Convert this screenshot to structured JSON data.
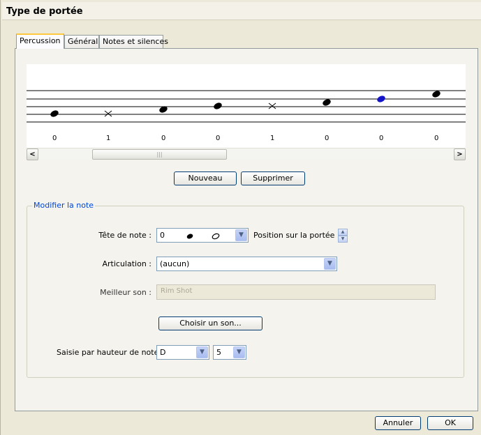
{
  "window": {
    "title": "Type de portée"
  },
  "tabs": [
    {
      "label": "Percussion",
      "active": true
    },
    {
      "label": "Général",
      "active": false
    },
    {
      "label": "Notes et silences",
      "active": false
    }
  ],
  "staff": {
    "notes": [
      {
        "head": "filled",
        "number": "0"
      },
      {
        "head": "x",
        "number": "1"
      },
      {
        "head": "filled",
        "number": "0"
      },
      {
        "head": "filled",
        "number": "0"
      },
      {
        "head": "x",
        "number": "1"
      },
      {
        "head": "filled",
        "number": "0"
      },
      {
        "head": "filled-selected",
        "number": "0"
      },
      {
        "head": "filled",
        "number": "0"
      }
    ],
    "selected_color": "#1414c8",
    "scroll_left_icon": "chevron-left-icon",
    "scroll_right_icon": "chevron-right-icon"
  },
  "buttons": {
    "new": "Nouveau",
    "delete": "Supprimer",
    "choose_sound": "Choisir un son...",
    "cancel": "Annuler",
    "ok": "OK"
  },
  "edit_note": {
    "legend": "Modifier la note",
    "notehead_label": "Tête de note :",
    "notehead_value": "0",
    "position_label": "Position sur la portée :",
    "articulation_label": "Articulation :",
    "articulation_value": "(aucun)",
    "best_sound_label": "Meilleur son :",
    "best_sound_value": "Rim Shot",
    "pitch_input_label": "Saisie par hauteur de note",
    "pitch_value": "D",
    "octave_value": "5"
  }
}
